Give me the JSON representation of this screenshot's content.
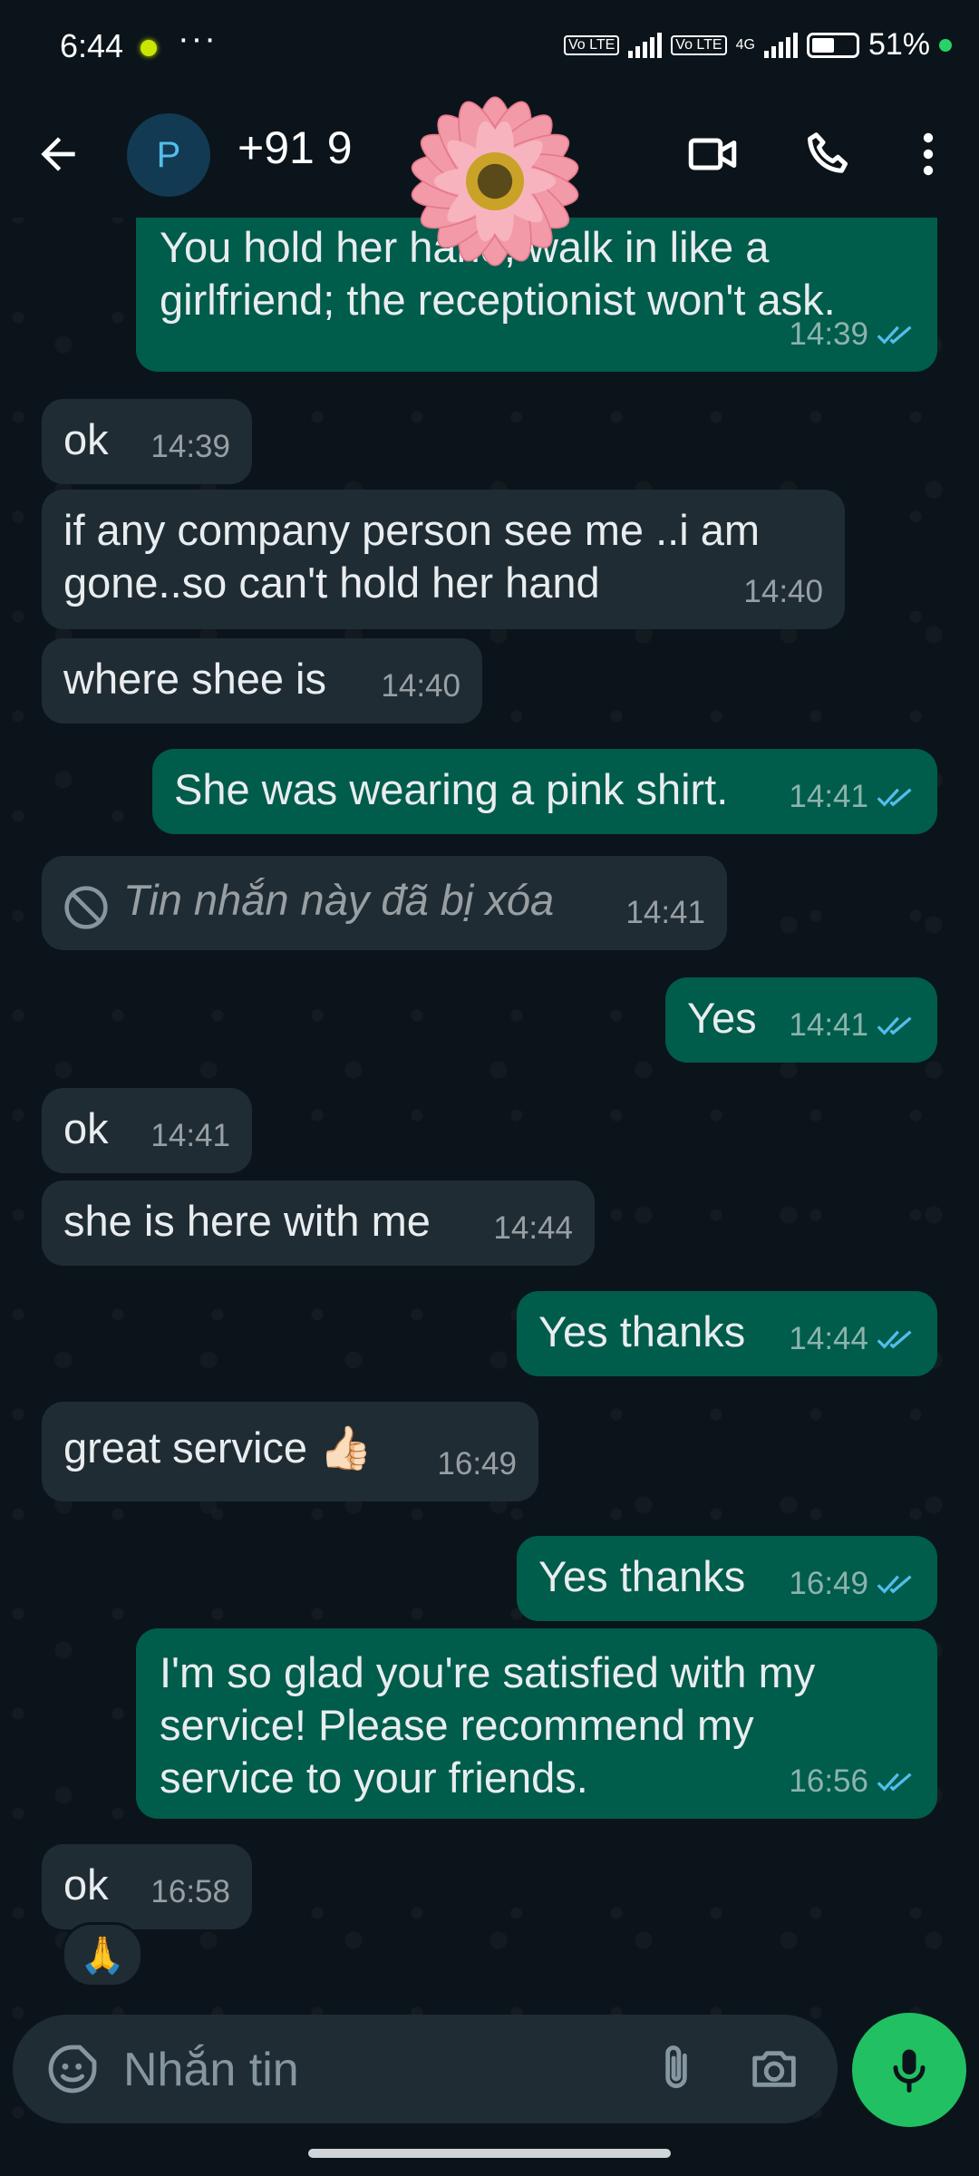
{
  "status": {
    "time": "6:44",
    "more": "···",
    "chip1": "Vo LTE",
    "chip2": "Vo LTE",
    "net": "4G",
    "battery": "51%"
  },
  "header": {
    "avatar_letter": "P",
    "contact_name": "+91 9"
  },
  "messages": [
    {
      "dir": "out",
      "text": "You hold her hand, walk in like a girlfriend; the receptionist won't ask.",
      "time": "14:39",
      "read": true
    },
    {
      "dir": "in",
      "text": "ok",
      "time": "14:39"
    },
    {
      "dir": "in",
      "text": "if any company person see me ..i am gone..so can't hold her hand",
      "time": "14:40"
    },
    {
      "dir": "in",
      "text": "where shee is",
      "time": "14:40"
    },
    {
      "dir": "out",
      "text": "She was wearing a pink shirt.",
      "time": "14:41",
      "read": true
    },
    {
      "dir": "in",
      "deleted": true,
      "text": "Tin nhắn này đã bị xóa",
      "time": "14:41"
    },
    {
      "dir": "out",
      "text": "Yes",
      "time": "14:41",
      "read": true
    },
    {
      "dir": "in",
      "text": "ok",
      "time": "14:41"
    },
    {
      "dir": "in",
      "text": "she is here with me",
      "time": "14:44"
    },
    {
      "dir": "out",
      "text": "Yes thanks",
      "time": "14:44",
      "read": true
    },
    {
      "dir": "in",
      "text": "great service 👍🏻",
      "time": "16:49"
    },
    {
      "dir": "out",
      "text": "Yes thanks",
      "time": "16:49",
      "read": true
    },
    {
      "dir": "out",
      "text": "I'm so glad you're satisfied with my service! Please recommend my service to your friends.",
      "time": "16:56",
      "read": true
    },
    {
      "dir": "in",
      "text": "ok",
      "time": "16:58",
      "reaction": "🙏"
    }
  ],
  "composer": {
    "placeholder": "Nhắn tin"
  },
  "colors": {
    "incoming": "#202c33",
    "outgoing": "#005c4b",
    "accent": "#21c063",
    "read_ticks": "#53bdeb"
  }
}
